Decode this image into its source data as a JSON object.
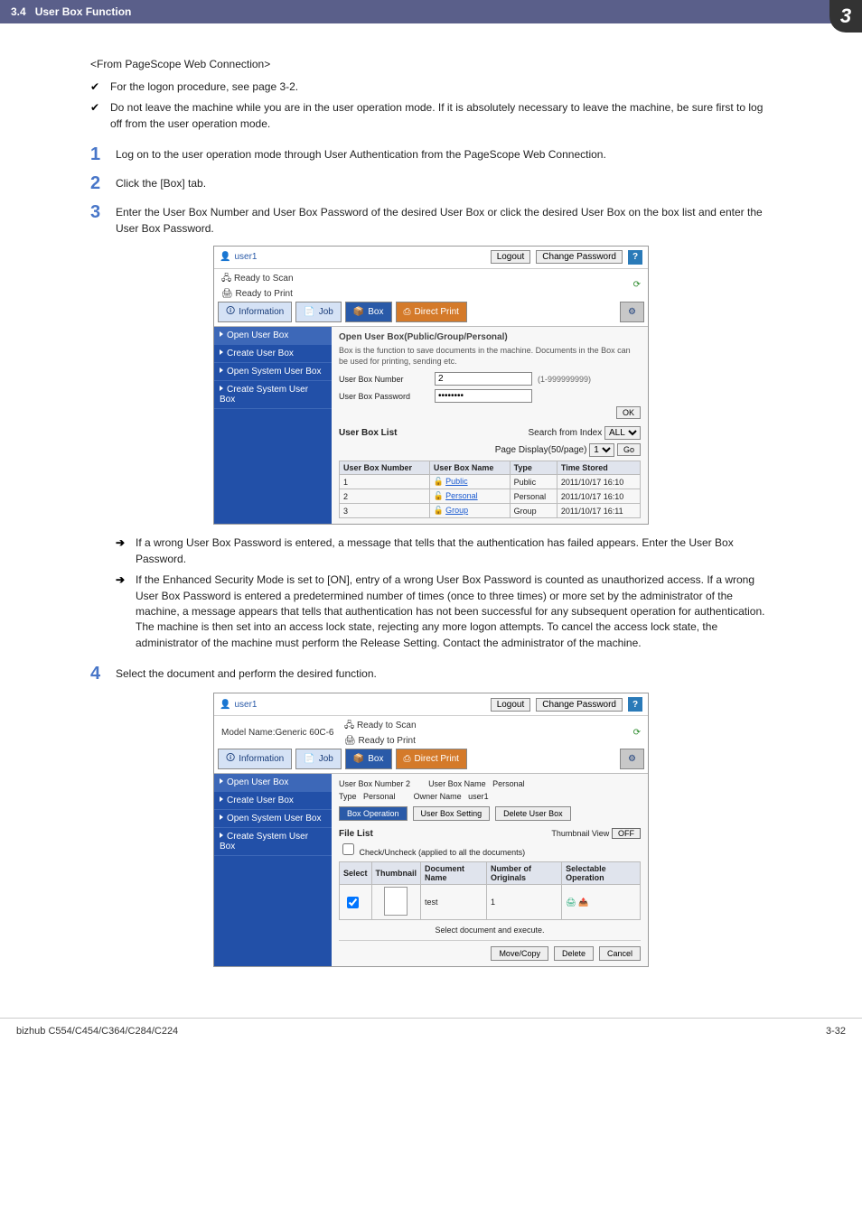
{
  "header": {
    "section": "3.4",
    "title": "User Box Function",
    "chapter": "3"
  },
  "text": {
    "subtitle": "<From PageScope Web Connection>",
    "note1": "For the logon procedure, see page 3-2.",
    "note2": "Do not leave the machine while you are in the user operation mode. If it is absolutely necessary to leave the machine, be sure first to log off from the user operation mode.",
    "arrow1": "If a wrong User Box Password is entered, a message that tells that the authentication has failed appears. Enter the User Box Password.",
    "arrow2": "If the Enhanced Security Mode is set to [ON], entry of a wrong User Box Password is counted as unauthorized access. If a wrong User Box Password is entered a predetermined number of times (once to three times) or more set by the administrator of the machine, a message appears that tells that authentication has not been successful for any subsequent operation for authentication. The machine is then set into an access lock state, rejecting any more logon attempts. To cancel the access lock state, the administrator of the machine must perform the Release Setting. Contact the administrator of the machine."
  },
  "steps": [
    {
      "num": "1",
      "text": "Log on to the user operation mode through User Authentication from the PageScope Web Connection."
    },
    {
      "num": "2",
      "text": "Click the [Box] tab."
    },
    {
      "num": "3",
      "text": "Enter the User Box Number and User Box Password of the desired User Box or click the desired User Box on the box list and enter the User Box Password."
    },
    {
      "num": "4",
      "text": "Select the document and perform the desired function."
    }
  ],
  "shot1": {
    "user": "user1",
    "logout": "Logout",
    "change_pw": "Change Password",
    "status_scan": "Ready to Scan",
    "status_print": "Ready to Print",
    "tabs": {
      "info": "Information",
      "job": "Job",
      "box": "Box",
      "direct": "Direct Print"
    },
    "sidebar": [
      "Open User Box",
      "Create User Box",
      "Open System User Box",
      "Create System User Box"
    ],
    "pane_title": "Open User Box(Public/Group/Personal)",
    "pane_note": "Box is the function to save documents in the machine. Documents in the Box can be used for printing, sending etc.",
    "form": {
      "num_label": "User Box Number",
      "num_value": "2",
      "range": "(1-999999999)",
      "pw_label": "User Box Password",
      "pw_value": "••••••••",
      "ok": "OK"
    },
    "list": {
      "title": "User Box List",
      "search_label": "Search from Index",
      "search_value": "ALL",
      "page_display": "Page Display(50/page)",
      "page_value": "1",
      "go": "Go",
      "cols": [
        "User Box Number",
        "User Box Name",
        "Type",
        "Time Stored"
      ],
      "rows": [
        {
          "num": "1",
          "name": "Public",
          "type": "Public",
          "time": "2011/10/17 16:10"
        },
        {
          "num": "2",
          "name": "Personal",
          "type": "Personal",
          "time": "2011/10/17 16:10"
        },
        {
          "num": "3",
          "name": "Group",
          "type": "Group",
          "time": "2011/10/17 16:11"
        }
      ]
    }
  },
  "shot2": {
    "user": "user1",
    "logout": "Logout",
    "change_pw": "Change Password",
    "model_label": "Model Name:",
    "model_value": "Generic 60C-6",
    "status_scan": "Ready to Scan",
    "status_print": "Ready to Print",
    "tabs": {
      "info": "Information",
      "job": "Job",
      "box": "Box",
      "direct": "Direct Print"
    },
    "sidebar": [
      "Open User Box",
      "Create User Box",
      "Open System User Box",
      "Create System User Box"
    ],
    "info": {
      "num_label": "User Box Number",
      "num_value": "2",
      "name_label": "User Box Name",
      "name_value": "Personal",
      "type_label": "Type",
      "type_value": "Personal",
      "owner_label": "Owner Name",
      "owner_value": "user1"
    },
    "btns": {
      "box_op": "Box Operation",
      "box_set": "User Box Setting",
      "del_box": "Delete User Box",
      "move_copy": "Move/Copy",
      "delete": "Delete",
      "cancel": "Cancel"
    },
    "file_list": {
      "title": "File List",
      "thumb_label": "Thumbnail View",
      "thumb_state": "OFF",
      "check_label": "Check/Uncheck (applied to all the documents)",
      "cols": [
        "Select",
        "Thumbnail",
        "Document Name",
        "Number of Originals",
        "Selectable Operation"
      ],
      "rows": [
        {
          "name": "test",
          "orig": "1"
        }
      ],
      "exec_note": "Select document and execute."
    }
  },
  "footer": {
    "product": "bizhub C554/C454/C364/C284/C224",
    "page": "3-32"
  }
}
